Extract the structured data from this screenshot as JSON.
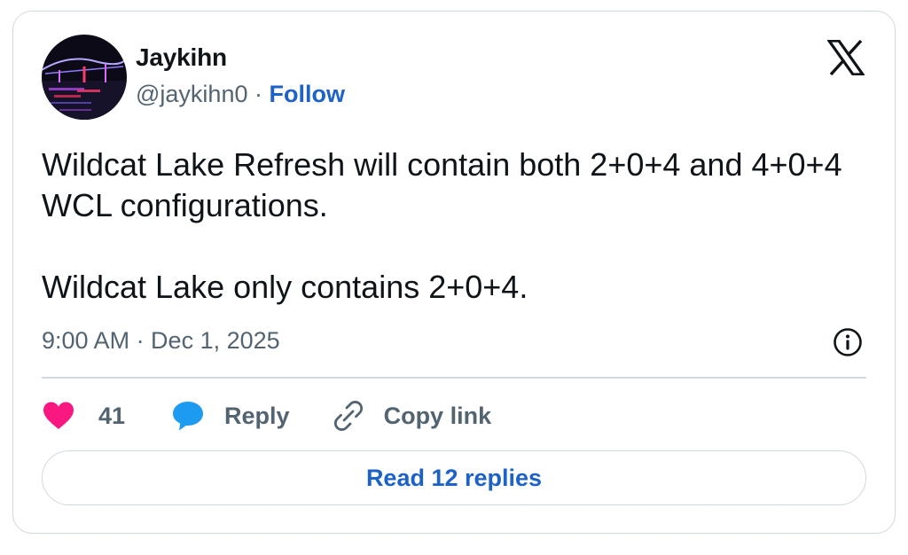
{
  "author": {
    "name": "Jaykihn",
    "handle": "@jaykihn0",
    "separator": "·",
    "follow_label": "Follow"
  },
  "tweet": {
    "paragraphs": [
      "Wildcat Lake Refresh will contain both 2+0+4 and 4+0+4 WCL configurations.",
      "Wildcat Lake only contains 2+0+4."
    ],
    "timestamp": "9:00 AM · Dec 1, 2025"
  },
  "actions": {
    "like_count": "41",
    "reply_label": "Reply",
    "copy_label": "Copy link"
  },
  "read_replies_label": "Read 12 replies",
  "icons": {
    "platform": "x-logo-icon",
    "info": "info-icon",
    "like": "heart-icon",
    "reply": "speech-bubble-icon",
    "copy": "link-icon"
  },
  "colors": {
    "accent": "#1d62c6",
    "like": "#f91880",
    "reply": "#1d9bf0",
    "secondary_text": "#536471",
    "border": "#cfd9de"
  }
}
